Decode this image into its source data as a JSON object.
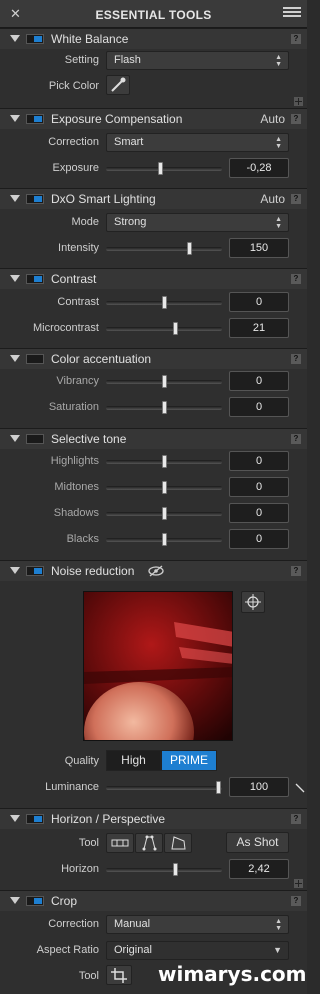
{
  "panel": {
    "title": "ESSENTIAL TOOLS"
  },
  "white_balance": {
    "title": "White Balance",
    "setting_label": "Setting",
    "setting_value": "Flash",
    "pick_label": "Pick Color"
  },
  "exposure": {
    "title": "Exposure Compensation",
    "auto": "Auto",
    "correction_label": "Correction",
    "correction_value": "Smart",
    "exposure_label": "Exposure",
    "exposure_value": "-0,28",
    "exposure_level": 0.47
  },
  "smart_lighting": {
    "title": "DxO Smart Lighting",
    "auto": "Auto",
    "mode_label": "Mode",
    "mode_value": "Strong",
    "intensity_label": "Intensity",
    "intensity_value": "150",
    "intensity_level": 0.72
  },
  "contrast": {
    "title": "Contrast",
    "contrast_label": "Contrast",
    "contrast_value": "0",
    "contrast_level": 0.5,
    "micro_label": "Microcontrast",
    "micro_value": "21",
    "micro_level": 0.6
  },
  "color_accent": {
    "title": "Color accentuation",
    "vibrancy_label": "Vibrancy",
    "vibrancy_value": "0",
    "saturation_label": "Saturation",
    "saturation_value": "0"
  },
  "selective_tone": {
    "title": "Selective tone",
    "highlights_label": "Highlights",
    "highlights_value": "0",
    "midtones_label": "Midtones",
    "midtones_value": "0",
    "shadows_label": "Shadows",
    "shadows_value": "0",
    "blacks_label": "Blacks",
    "blacks_value": "0"
  },
  "noise": {
    "title": "Noise reduction",
    "quality_label": "Quality",
    "quality_high": "High",
    "quality_prime": "PRIME",
    "luminance_label": "Luminance",
    "luminance_value": "100",
    "luminance_level": 0.97
  },
  "horizon": {
    "title": "Horizon / Perspective",
    "tool_label": "Tool",
    "as_shot": "As Shot",
    "horizon_label": "Horizon",
    "horizon_value": "2,42",
    "horizon_level": 0.6
  },
  "crop": {
    "title": "Crop",
    "correction_label": "Correction",
    "correction_value": "Manual",
    "aspect_label": "Aspect Ratio",
    "aspect_value": "Original",
    "tool_label": "Tool"
  },
  "help_glyph": "?",
  "watermark": "wimarys.com",
  "colors": {
    "accent": "#1e7fd1",
    "panel_bg": "#2f2f2f"
  }
}
